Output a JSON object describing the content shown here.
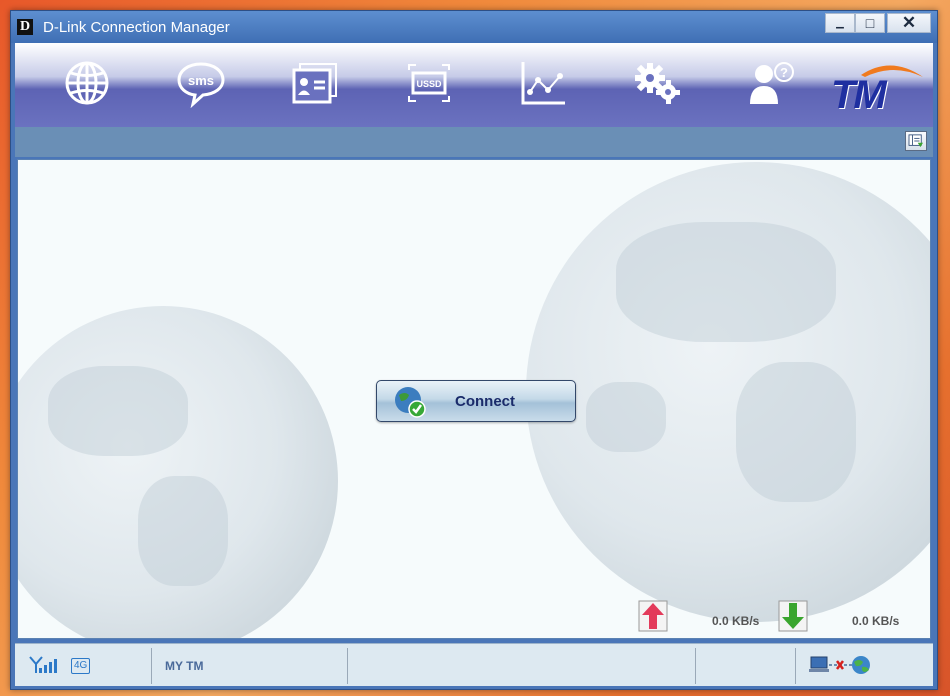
{
  "window": {
    "title": "D-Link Connection Manager",
    "logo_letter": "D",
    "minimize_label": "▁",
    "maximize_label": "□",
    "close_label": "✕"
  },
  "toolbar": {
    "items": [
      {
        "id": "internet",
        "icon": "globe-icon"
      },
      {
        "id": "sms",
        "icon": "sms-icon",
        "label": "sms"
      },
      {
        "id": "contacts",
        "icon": "contacts-icon"
      },
      {
        "id": "ussd",
        "icon": "ussd-icon",
        "label": "USSD"
      },
      {
        "id": "statistics",
        "icon": "chart-icon"
      },
      {
        "id": "settings",
        "icon": "gears-icon"
      },
      {
        "id": "help",
        "icon": "help-user-icon"
      }
    ],
    "brand": "TM"
  },
  "main": {
    "connect_label": "Connect",
    "upload_rate": "0.0 KB/s",
    "download_rate": "0.0 KB/s"
  },
  "status": {
    "signal_icon": "signal-bars-icon",
    "network_type": "4G",
    "operator": "MY TM",
    "connection_icon": "disconnected-icon"
  },
  "colors": {
    "titlebar": "#4a7ec4",
    "toolbar_accent": "#5d63b4",
    "brand_blue": "#1f2fa0",
    "brand_orange": "#f07a1e",
    "upload_arrow": "#e33a5a",
    "download_arrow": "#3aa52e"
  }
}
